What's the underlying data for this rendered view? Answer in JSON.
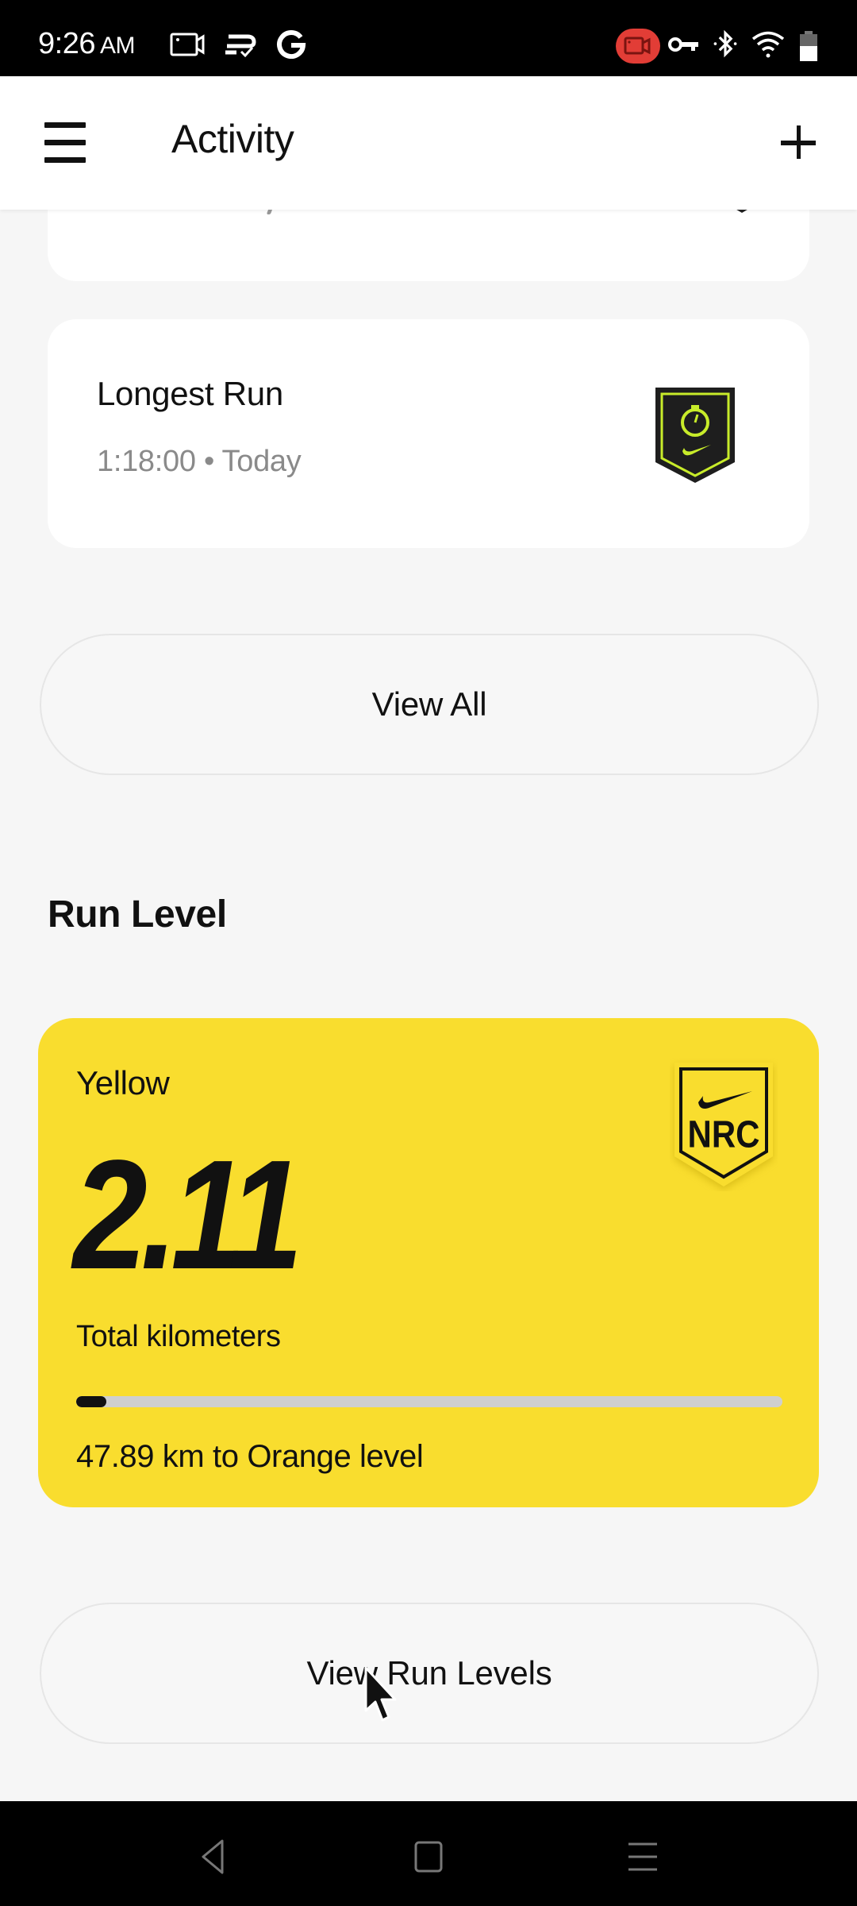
{
  "status_bar": {
    "time": "9:26",
    "ampm": "AM",
    "left_icons": [
      "screen-record-icon",
      "sync-check-icon",
      "google-icon"
    ],
    "right_icons": [
      "recording-indicator-icon",
      "vpn-key-icon",
      "bluetooth-icon",
      "wifi-icon",
      "battery-icon"
    ],
    "recording_color": "#e23d36"
  },
  "app_bar": {
    "menu_icon": "hamburger-menu-icon",
    "title": "Activity",
    "add_icon": "plus-icon"
  },
  "achievements": [
    {
      "title": "Longest Run",
      "value": "1:18:00",
      "separator": "•",
      "date": "Today",
      "badge_icon": "stopwatch-badge-icon",
      "badge_colors": {
        "background": "#1e1e1e",
        "accent": "#c8ec2a"
      }
    }
  ],
  "view_all_button": "View All",
  "run_level": {
    "section_title": "Run Level",
    "level_name": "Yellow",
    "total_distance": "2.11",
    "unit_label": "Total kilometers",
    "progress_fraction": 0.0422,
    "remaining_text": "47.89 km to Orange level",
    "badge_text": "NRC",
    "card_color": "#f9dd2e"
  },
  "view_run_levels_button": "View Run Levels",
  "nav_bar": {
    "buttons": [
      "back-icon",
      "home-icon",
      "recents-icon"
    ]
  }
}
